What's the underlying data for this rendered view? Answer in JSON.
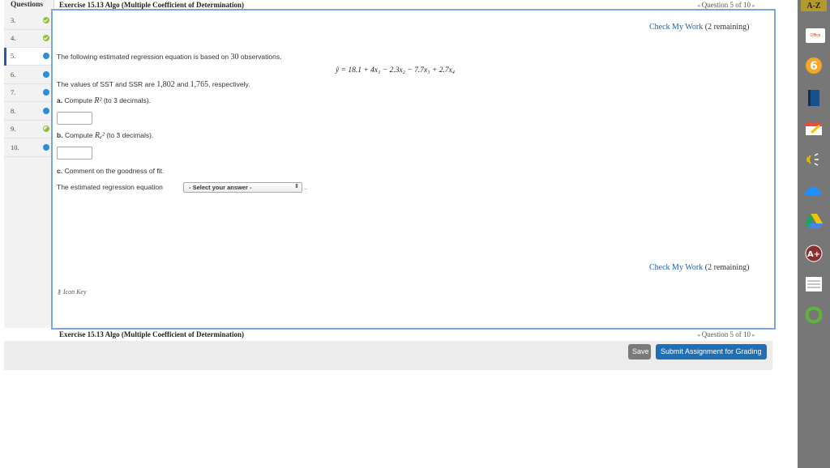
{
  "nav": {
    "title": "Questions",
    "items": [
      {
        "num": "3.",
        "status": "check"
      },
      {
        "num": "4.",
        "status": "check"
      },
      {
        "num": "5.",
        "status": "dot"
      },
      {
        "num": "6.",
        "status": "dot"
      },
      {
        "num": "7.",
        "status": "dot"
      },
      {
        "num": "8.",
        "status": "dot"
      },
      {
        "num": "9.",
        "status": "partial"
      },
      {
        "num": "10.",
        "status": "dot"
      }
    ]
  },
  "header": {
    "title": "Exercise 15.13 Algo (Multiple Coefficient of Determination)",
    "pager": "Question 5 of 10",
    "prev": "◂",
    "next": "▸"
  },
  "check_work": {
    "link": "Check My Work",
    "remaining": "(2 remaining)"
  },
  "question": {
    "intro_pre": "The following estimated regression equation is based on",
    "intro_num": "30",
    "intro_post": "observations.",
    "equation": "ŷ = 18.1 + 4x₁ − 2.3x₂ − 7.7x₃ + 2.7x₄",
    "sst_pre": "The values of SST and SSR are",
    "sst_val": "1,802",
    "sst_mid": "and",
    "ssr_val": "1,765",
    "sst_post": ", respectively.",
    "part_a_label": "a.",
    "part_a_text": "Compute",
    "part_a_sym": "R²",
    "part_a_note": "(to 3 decimals).",
    "part_b_label": "b.",
    "part_b_text": "Compute",
    "part_b_sym": "Rₐ²",
    "part_b_note": "(to 3 decimals).",
    "part_c_label": "c.",
    "part_c_text": "Comment on the goodness of fit.",
    "part_c_sentence": "The estimated regression equation",
    "select_value": "- Select your answer -",
    "period": "."
  },
  "icon_key": "Icon Key",
  "footer": {
    "title": "Exercise 15.13 Algo (Multiple Coefficient of Determination)",
    "pager": "Question 5 of 10",
    "save": "Save",
    "submit": "Submit Assignment for Grading"
  },
  "extensions": {
    "az": "A-Z",
    "office": "Office"
  }
}
